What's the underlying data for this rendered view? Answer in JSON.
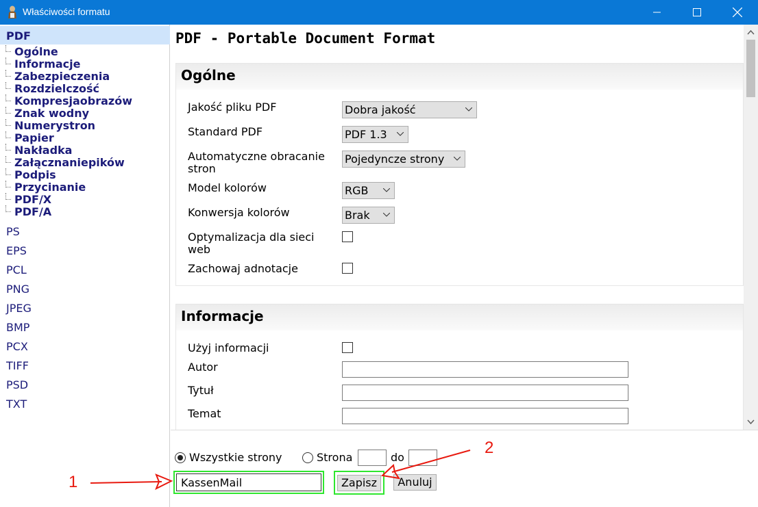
{
  "window": {
    "title": "Właściwości formatu"
  },
  "sidebar": {
    "active": "PDF",
    "pdf_items": [
      "Ogólne",
      "Informacje",
      "Zabezpieczenia",
      "Rozdzielczość",
      "Kompresjaobrazów",
      "Znak wodny",
      "Numerystron",
      "Papier",
      "Nakładka",
      "Załącznaniepików",
      "Podpis",
      "Przycinanie",
      "PDF/X",
      "PDF/A"
    ],
    "formats": [
      "PS",
      "EPS",
      "PCL",
      "PNG",
      "JPEG",
      "BMP",
      "PCX",
      "TIFF",
      "PSD",
      "TXT"
    ]
  },
  "main": {
    "page_title": "PDF - Portable Document Format",
    "general": {
      "heading": "Ogólne",
      "quality_label": "Jakość pliku PDF",
      "quality_value": "Dobra jakość",
      "standard_label": "Standard PDF",
      "standard_value": "PDF 1.3",
      "rotate_label_1": "Automatyczne obracanie",
      "rotate_label_2": "stron",
      "rotate_value": "Pojedyncze strony",
      "color_model_label": "Model kolorów",
      "color_model_value": "RGB",
      "color_conv_label": "Konwersja kolorów",
      "color_conv_value": "Brak",
      "web_opt_label_1": "Optymalizacja dla sieci",
      "web_opt_label_2": "web",
      "keep_annot_label": "Zachowaj adnotacje"
    },
    "info": {
      "heading": "Informacje",
      "use_info_label": "Użyj informacji",
      "author_label": "Autor",
      "title_label": "Tytuł",
      "subject_label": "Temat"
    }
  },
  "bottom": {
    "all_pages_label": "Wszystkie strony",
    "page_label": "Strona",
    "to_label": "do",
    "name_value": "KassenMail",
    "save_label": "Zapisz",
    "cancel_label": "Anuluj"
  },
  "annotations": {
    "marker_1": "1",
    "marker_2": "2",
    "color": "#e8190f",
    "highlight_color": "#2ee62e"
  }
}
